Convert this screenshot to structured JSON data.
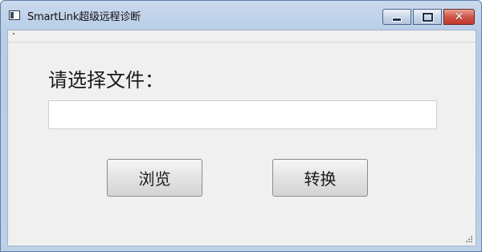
{
  "window": {
    "title": "SmartLink超级远程诊断",
    "controls": {
      "minimize_icon": "minimize-icon",
      "maximize_icon": "maximize-icon",
      "close_icon": "close-icon",
      "close_glyph": "✕"
    }
  },
  "main": {
    "prompt_label": "请选择文件：",
    "file_path": {
      "value": "",
      "placeholder": ""
    },
    "browse_label": "浏览",
    "convert_label": "转换"
  },
  "colors": {
    "close_button": "#c84a3e",
    "title_bar": "#c9d9ee",
    "client_background": "#f0f0f0"
  }
}
